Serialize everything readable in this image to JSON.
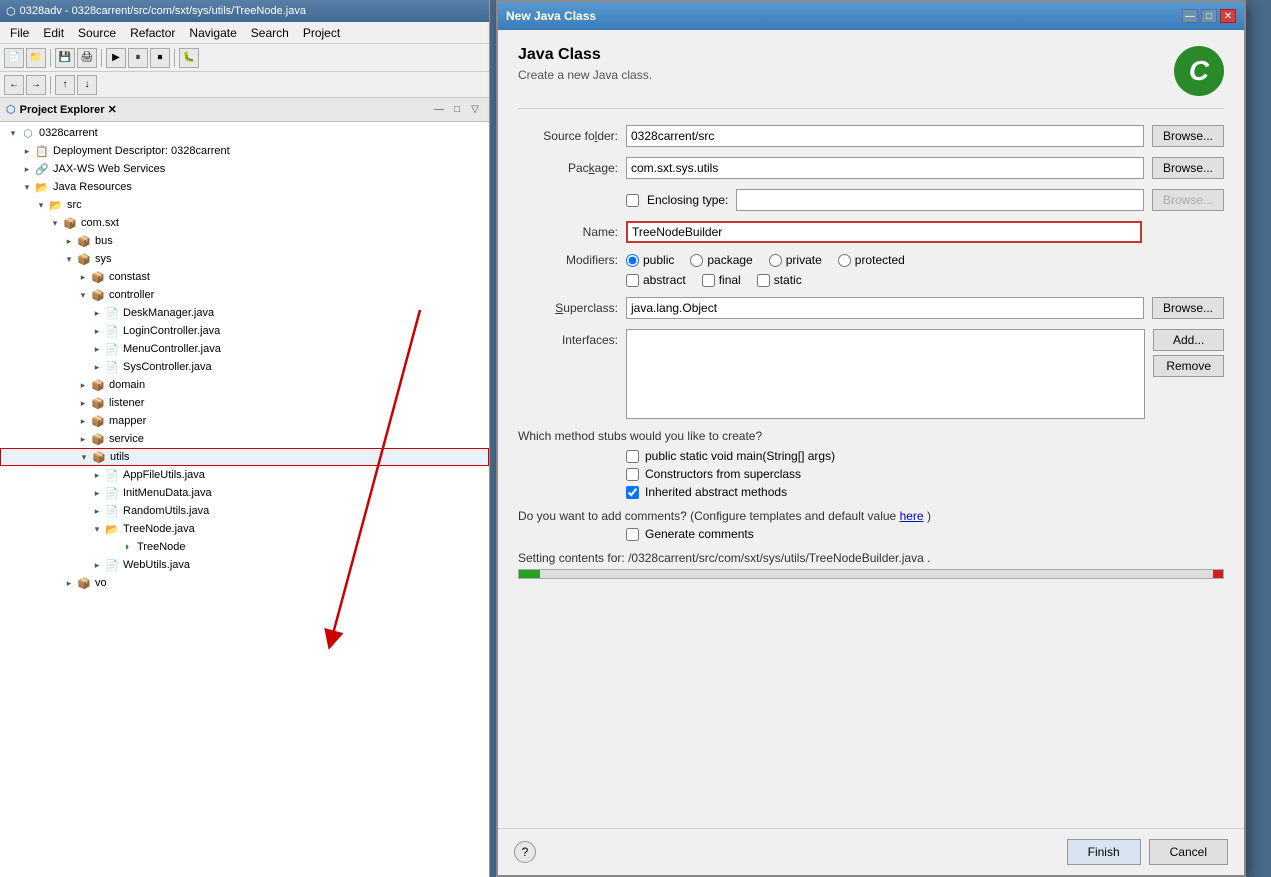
{
  "titleBar": {
    "text": "0328adv - 0328carrent/src/com/sxt/sys/utils/TreeNode.java"
  },
  "menuBar": {
    "items": [
      "File",
      "Edit",
      "Source",
      "Refactor",
      "Navigate",
      "Search",
      "Project"
    ]
  },
  "projectExplorer": {
    "title": "Project Explorer",
    "rootProject": "0328carrent",
    "tree": [
      {
        "label": "0328carrent",
        "level": 0,
        "type": "project",
        "expanded": true
      },
      {
        "label": "Deployment Descriptor: 0328carrent",
        "level": 1,
        "type": "descriptor",
        "expanded": false
      },
      {
        "label": "JAX-WS Web Services",
        "level": 1,
        "type": "webservice",
        "expanded": false
      },
      {
        "label": "Java Resources",
        "level": 1,
        "type": "folder",
        "expanded": true
      },
      {
        "label": "src",
        "level": 2,
        "type": "folder",
        "expanded": true
      },
      {
        "label": "com.sxt",
        "level": 3,
        "type": "package",
        "expanded": true
      },
      {
        "label": "bus",
        "level": 4,
        "type": "package",
        "expanded": false
      },
      {
        "label": "sys",
        "level": 4,
        "type": "package",
        "expanded": true
      },
      {
        "label": "constast",
        "level": 5,
        "type": "package",
        "expanded": false
      },
      {
        "label": "controller",
        "level": 5,
        "type": "package",
        "expanded": true
      },
      {
        "label": "DeskManager.java",
        "level": 6,
        "type": "java",
        "expanded": false
      },
      {
        "label": "LoginController.java",
        "level": 6,
        "type": "java",
        "expanded": false
      },
      {
        "label": "MenuController.java",
        "level": 6,
        "type": "java",
        "expanded": false
      },
      {
        "label": "SysController.java",
        "level": 6,
        "type": "java",
        "expanded": false
      },
      {
        "label": "domain",
        "level": 5,
        "type": "package",
        "expanded": false
      },
      {
        "label": "listener",
        "level": 5,
        "type": "package",
        "expanded": false
      },
      {
        "label": "mapper",
        "level": 5,
        "type": "package",
        "expanded": false
      },
      {
        "label": "service",
        "level": 5,
        "type": "package",
        "expanded": false
      },
      {
        "label": "utils",
        "level": 5,
        "type": "package",
        "expanded": true,
        "highlighted": true
      },
      {
        "label": "AppFileUtils.java",
        "level": 6,
        "type": "java",
        "expanded": false
      },
      {
        "label": "InitMenuData.java",
        "level": 6,
        "type": "java",
        "expanded": false
      },
      {
        "label": "RandomUtils.java",
        "level": 6,
        "type": "java",
        "expanded": false
      },
      {
        "label": "TreeNode.java",
        "level": 6,
        "type": "folder",
        "expanded": true
      },
      {
        "label": "TreeNode",
        "level": 7,
        "type": "class",
        "expanded": false
      },
      {
        "label": "WebUtils.java",
        "level": 6,
        "type": "java",
        "expanded": false
      },
      {
        "label": "vo",
        "level": 4,
        "type": "package",
        "expanded": false
      }
    ]
  },
  "dialog": {
    "title": "New Java Class",
    "headerTitle": "Java Class",
    "headerSubtitle": "Create a new Java class.",
    "logoText": "C",
    "sourceFolder": {
      "label": "Source folder:",
      "value": "0328carrent/src"
    },
    "package": {
      "label": "Package:",
      "value": "com.sxt.sys.utils"
    },
    "enclosingType": {
      "label": "Enclosing type:",
      "value": "",
      "checked": false
    },
    "name": {
      "label": "Name:",
      "value": "TreeNodeBuilder"
    },
    "modifiers": {
      "label": "Modifiers:",
      "options": [
        "public",
        "package",
        "private",
        "protected"
      ],
      "selected": "public",
      "extras": [
        "abstract",
        "final",
        "static"
      ]
    },
    "superclass": {
      "label": "Superclass:",
      "value": "java.lang.Object"
    },
    "interfaces": {
      "label": "Interfaces:"
    },
    "stubs": {
      "label": "Which method stubs would you like to create?",
      "options": [
        {
          "label": "public static void main(String[] args)",
          "checked": false
        },
        {
          "label": "Constructors from superclass",
          "checked": false
        },
        {
          "label": "Inherited abstract methods",
          "checked": true
        }
      ]
    },
    "comments": {
      "question": "Do you want to add comments? (Configure templates and default value",
      "hereLink": "here",
      "questionEnd": ")",
      "generateLabel": "Generate comments",
      "generateChecked": false
    },
    "status": {
      "text": "Setting contents for: /0328carrent/src/com/sxt/sys/utils/TreeNodeBuilder.java .",
      "progressPercent": 3
    },
    "buttons": {
      "finish": "Finish",
      "cancel": "Cancel"
    }
  }
}
